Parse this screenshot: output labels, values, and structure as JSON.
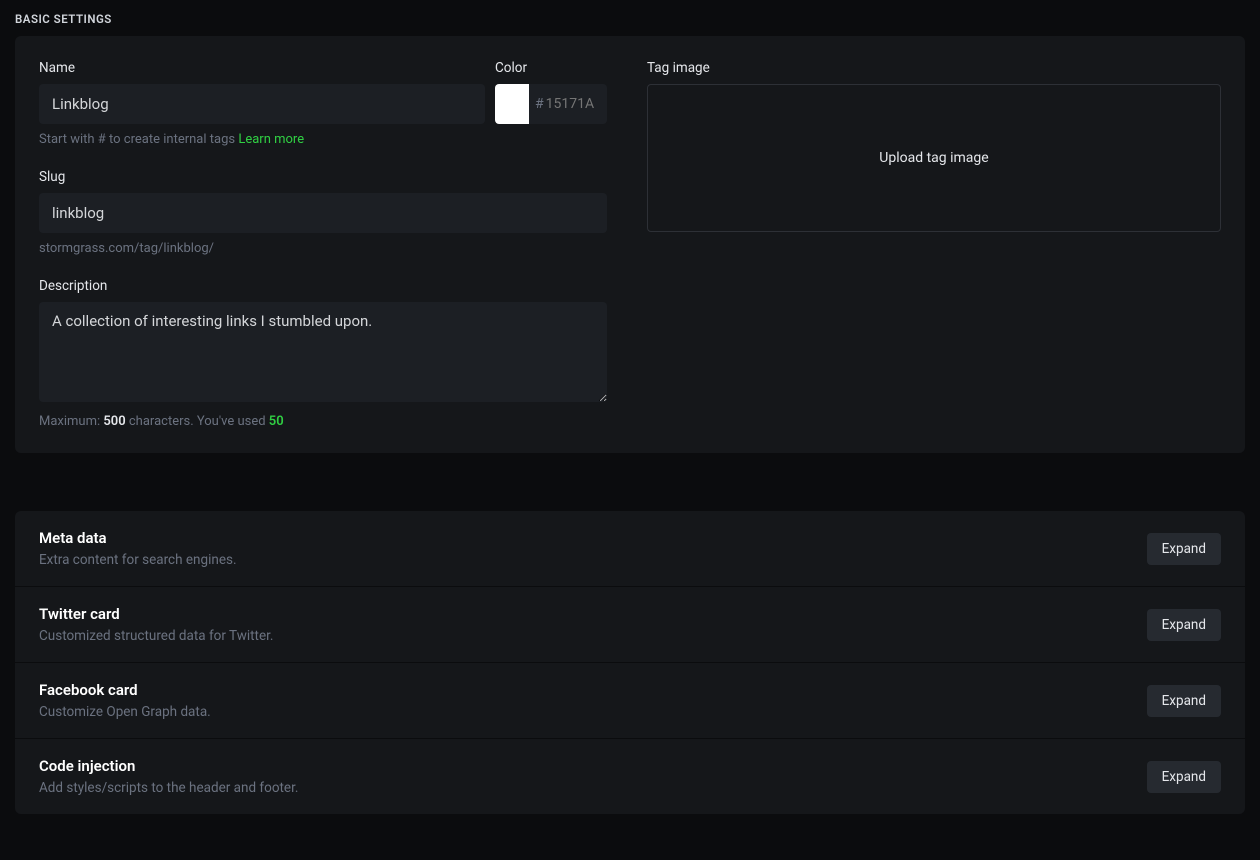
{
  "heading": "BASIC SETTINGS",
  "name": {
    "label": "Name",
    "value": "Linkblog",
    "hint_prefix": "Start with # to create internal tags ",
    "hint_link": "Learn more"
  },
  "color": {
    "label": "Color",
    "swatch": "#ffffff",
    "placeholder": "15171A",
    "prefix": "#"
  },
  "slug": {
    "label": "Slug",
    "value": "linkblog",
    "hint": "stormgrass.com/tag/linkblog/"
  },
  "description": {
    "label": "Description",
    "value": "A collection of interesting links I stumbled upon.",
    "hint_p1": "Maximum: ",
    "hint_max": "500",
    "hint_p2": " characters. You've used ",
    "hint_used": "50"
  },
  "tag_image": {
    "label": "Tag image",
    "upload_text": "Upload tag image"
  },
  "sections": [
    {
      "title": "Meta data",
      "subtitle": "Extra content for search engines.",
      "button": "Expand"
    },
    {
      "title": "Twitter card",
      "subtitle": "Customized structured data for Twitter.",
      "button": "Expand"
    },
    {
      "title": "Facebook card",
      "subtitle": "Customize Open Graph data.",
      "button": "Expand"
    },
    {
      "title": "Code injection",
      "subtitle": "Add styles/scripts to the header and footer.",
      "button": "Expand"
    }
  ]
}
